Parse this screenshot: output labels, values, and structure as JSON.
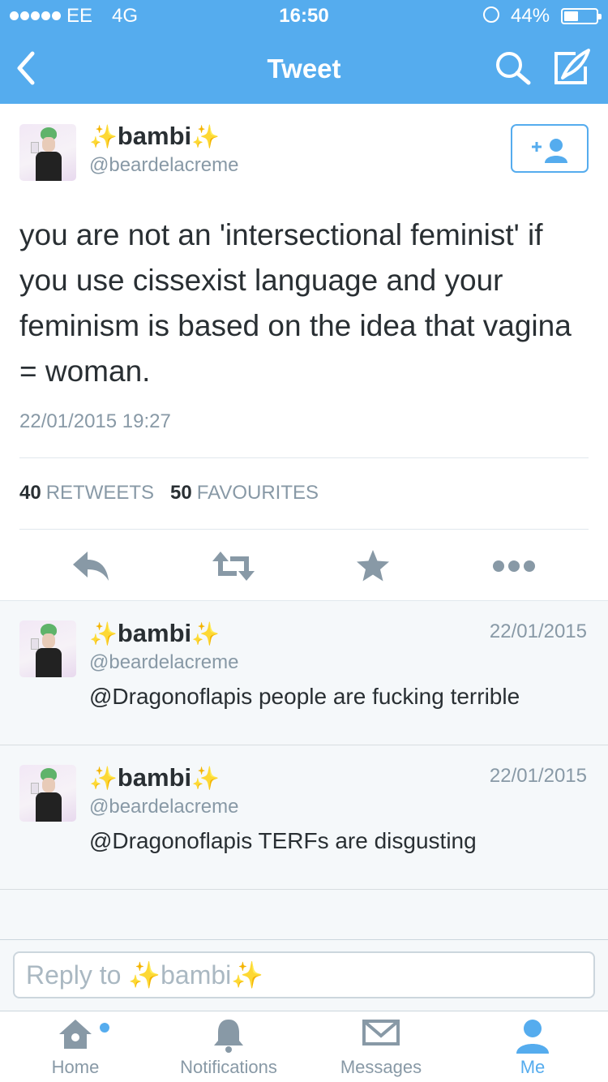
{
  "status_bar": {
    "carrier": "EE",
    "network": "4G",
    "time": "16:50",
    "battery_percent": "44%",
    "battery_level": 0.44
  },
  "nav": {
    "title": "Tweet"
  },
  "main_tweet": {
    "sparkle_left": "✨",
    "display_name": "bambi",
    "sparkle_right": "✨",
    "handle": "@beardelacreme",
    "text": "you are not an 'intersectional feminist' if you use cissexist language and your feminism is based on the idea that vagina = woman.",
    "timestamp": "22/01/2015 19:27",
    "retweets_count": "40",
    "retweets_label": "RETWEETS",
    "favourites_count": "50",
    "favourites_label": "FAVOURITES"
  },
  "replies": [
    {
      "sparkle_left": "✨",
      "display_name": "bambi",
      "sparkle_right": "✨",
      "handle": "@beardelacreme",
      "date": "22/01/2015",
      "text": "@Dragonoflapis people are fucking terrible"
    },
    {
      "sparkle_left": "✨",
      "display_name": "bambi",
      "sparkle_right": "✨",
      "handle": "@beardelacreme",
      "date": "22/01/2015",
      "text": "@Dragonoflapis TERFs are disgusting"
    }
  ],
  "reply_box": {
    "placeholder": "Reply to ✨bambi✨"
  },
  "tabs": [
    {
      "label": "Home",
      "icon": "home-icon"
    },
    {
      "label": "Notifications",
      "icon": "bell-icon"
    },
    {
      "label": "Messages",
      "icon": "envelope-icon"
    },
    {
      "label": "Me",
      "icon": "person-icon"
    }
  ],
  "colors": {
    "brand_blue": "#55acee",
    "muted_gray": "#8899a6",
    "text_dark": "#292f33"
  }
}
